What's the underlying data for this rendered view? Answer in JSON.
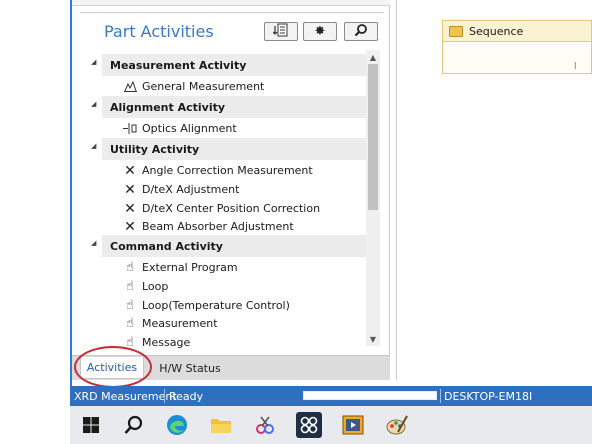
{
  "panel": {
    "title": "Part Activities",
    "toolbar": {
      "sort_icon": "document-sort-icon",
      "settings_icon": "gear-icon",
      "search_icon": "search-icon"
    }
  },
  "tree": {
    "categories": [
      {
        "label": "Measurement Activity",
        "items": [
          {
            "label": "General Measurement",
            "icon": "chart-icon"
          }
        ]
      },
      {
        "label": "Alignment Activity",
        "items": [
          {
            "label": "Optics Alignment",
            "icon": "optics-icon"
          }
        ]
      },
      {
        "label": "Utility Activity",
        "items": [
          {
            "label": "Angle Correction Measurement",
            "icon": "tools-icon"
          },
          {
            "label": "D/teX Adjustment",
            "icon": "tools-icon"
          },
          {
            "label": "D/teX Center Position Correction",
            "icon": "tools-icon"
          },
          {
            "label": "Beam Absorber Adjustment",
            "icon": "tools-icon"
          }
        ]
      },
      {
        "label": "Command Activity",
        "items": [
          {
            "label": "External Program",
            "icon": "hand-pointer-icon"
          },
          {
            "label": "Loop",
            "icon": "hand-pointer-icon"
          },
          {
            "label": "Loop(Temperature Control)",
            "icon": "hand-pointer-icon"
          },
          {
            "label": "Measurement",
            "icon": "hand-pointer-icon"
          },
          {
            "label": "Message",
            "icon": "hand-pointer-icon"
          }
        ]
      }
    ]
  },
  "tabs": {
    "activities": "Activities",
    "hw_status": "H/W Status"
  },
  "right_pane": {
    "sequence_label": "Sequence",
    "sequence_mark": "l"
  },
  "statusbar": {
    "app": "XRD Measurement",
    "state": "Ready",
    "host": "DESKTOP-EM18I"
  },
  "taskbar": {
    "icons": [
      "windows-start-icon",
      "search-icon",
      "edge-icon",
      "file-explorer-icon",
      "snipping-tool-icon",
      "app-icon",
      "media-player-icon",
      "paint-icon"
    ]
  },
  "colors": {
    "accent": "#2f6fbf",
    "title": "#3a78c6",
    "annotation": "#c92a3a"
  }
}
